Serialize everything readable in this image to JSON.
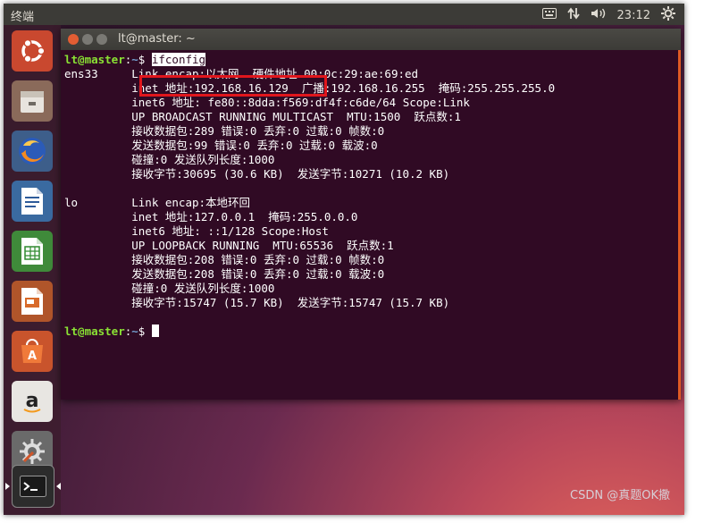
{
  "topbar": {
    "app_name": "终端",
    "time": "23:12",
    "icons": [
      "keyboard-icon",
      "network-arrows-icon",
      "volume-icon",
      "power-gear-icon"
    ]
  },
  "launcher": {
    "items": [
      {
        "name": "ubuntu-dash-icon"
      },
      {
        "name": "files-icon"
      },
      {
        "name": "firefox-icon"
      },
      {
        "name": "libreoffice-writer-icon"
      },
      {
        "name": "libreoffice-calc-icon"
      },
      {
        "name": "libreoffice-impress-icon"
      },
      {
        "name": "software-center-icon"
      },
      {
        "name": "amazon-icon"
      },
      {
        "name": "system-settings-icon"
      },
      {
        "name": "terminal-icon",
        "active": true
      }
    ]
  },
  "window": {
    "title": "lt@master: ~"
  },
  "terminal": {
    "prompt_user": "lt@master",
    "prompt_sep": ":",
    "prompt_path": "~",
    "prompt_symbol": "$ ",
    "command": "ifconfig",
    "lines": [
      "ens33     Link encap:以太网  硬件地址 00:0c:29:ae:69:ed",
      "          inet 地址:192.168.16.129  广播:192.168.16.255  掩码:255.255.255.0",
      "          inet6 地址: fe80::8dda:f569:df4f:c6de/64 Scope:Link",
      "          UP BROADCAST RUNNING MULTICAST  MTU:1500  跃点数:1",
      "          接收数据包:289 错误:0 丢弃:0 过载:0 帧数:0",
      "          发送数据包:99 错误:0 丢弃:0 过载:0 载波:0",
      "          碰撞:0 发送队列长度:1000",
      "          接收字节:30695 (30.6 KB)  发送字节:10271 (10.2 KB)",
      "",
      "lo        Link encap:本地环回",
      "          inet 地址:127.0.0.1  掩码:255.0.0.0",
      "          inet6 地址: ::1/128 Scope:Host",
      "          UP LOOPBACK RUNNING  MTU:65536  跃点数:1",
      "          接收数据包:208 错误:0 丢弃:0 过载:0 帧数:0",
      "          发送数据包:208 错误:0 丢弃:0 过载:0 载波:0",
      "          碰撞:0 发送队列长度:1000",
      "          接收字节:15747 (15.7 KB)  发送字节:15747 (15.7 KB)",
      ""
    ]
  },
  "watermark": "CSDN @真题OK撒",
  "colors": {
    "terminal_bg": "#300a24",
    "prompt_user": "#8ae234",
    "prompt_path": "#729fcf",
    "highlight_box": "#e0161c",
    "close_button": "#e25d33"
  }
}
